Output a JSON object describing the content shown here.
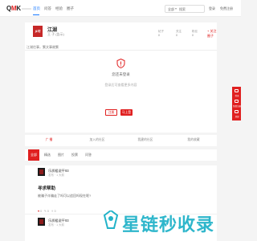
{
  "brand": {
    "logo_text": "QMK"
  },
  "nav": {
    "links": [
      "首页",
      "问答",
      "经验",
      "圈子"
    ]
  },
  "search": {
    "scope": "全部",
    "placeholder": "搜索"
  },
  "top_buttons": [
    "登录",
    "免费注册"
  ],
  "group": {
    "avatar_text": "乡村",
    "name": "江湖",
    "subtitle": "王 子 (告示)",
    "stats": [
      [
        "帖子",
        "8"
      ],
      [
        "关注",
        "8"
      ],
      [
        "粉丝",
        "8"
      ]
    ],
    "join_label": "+ 关注圈子",
    "intro": "江湖往事，繁文事故繁"
  },
  "login_prompt": {
    "title": "您还未登录",
    "desc": "登录后可查看更多内容",
    "register_label": "注册",
    "login_label": "马上登录"
  },
  "actions": [
    "广 播",
    "加入的社区",
    "我建的社区",
    "我的收藏"
  ],
  "tabs": [
    "全部",
    "精选",
    "图片",
    "投票",
    "问答"
  ],
  "posts": [
    {
      "user": "乐质粗说平93",
      "meta": "发布 · 1 大前",
      "title": "寻求帮助",
      "body": "被骗子诈骗走了吗可以追回吗现在呢?",
      "stats": {
        "likes": "0",
        "comments": "0",
        "shares": "0"
      }
    },
    {
      "user": "乐质粗说平93",
      "meta": "发布 · 1 大前"
    }
  ],
  "side_float": [
    "登录",
    "免费注册",
    "顶部"
  ],
  "watermark": "星链秒收录",
  "colors": {
    "accent": "#e02020",
    "link": "#1677ff",
    "watermark": "#23b3c9"
  }
}
